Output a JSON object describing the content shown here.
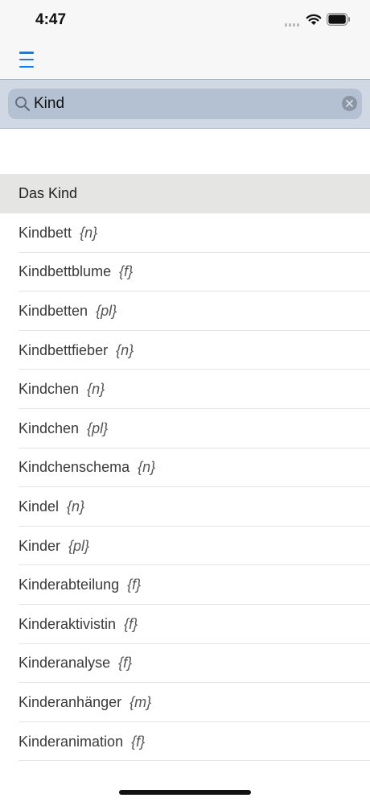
{
  "status_bar": {
    "time": "4:47",
    "icons": [
      "cellular-signal-icon",
      "wifi-icon",
      "battery-icon"
    ]
  },
  "nav_bar": {
    "menu_icon": "hamburger-menu-icon",
    "accent_color": "#1a7ae6"
  },
  "search": {
    "value": "Kind",
    "icon": "magnifier-icon",
    "clear_icon": "clear-circle-icon"
  },
  "results": {
    "header": "Das Kind",
    "items": [
      {
        "word": "Kindbett",
        "gender": "{n}"
      },
      {
        "word": "Kindbettblume",
        "gender": "{f}"
      },
      {
        "word": "Kindbetten",
        "gender": "{pl}"
      },
      {
        "word": "Kindbettfieber",
        "gender": "{n}"
      },
      {
        "word": "Kindchen",
        "gender": "{n}"
      },
      {
        "word": "Kindchen",
        "gender": "{pl}"
      },
      {
        "word": "Kindchenschema",
        "gender": "{n}"
      },
      {
        "word": "Kindel",
        "gender": "{n}"
      },
      {
        "word": "Kinder",
        "gender": "{pl}"
      },
      {
        "word": "Kinderabteilung",
        "gender": "{f}"
      },
      {
        "word": "Kinderaktivistin",
        "gender": "{f}"
      },
      {
        "word": "Kinderanalyse",
        "gender": "{f}"
      },
      {
        "word": "Kinderanhänger",
        "gender": "{m}"
      },
      {
        "word": "Kinderanimation",
        "gender": "{f}"
      }
    ]
  }
}
